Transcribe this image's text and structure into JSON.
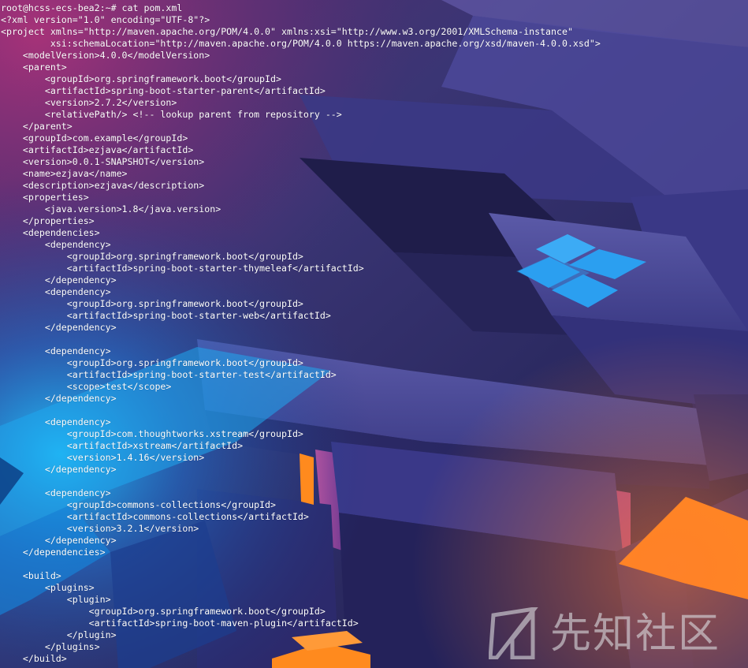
{
  "terminal": {
    "lines": [
      "root@hcss-ecs-bea2:~# cat pom.xml",
      "<?xml version=\"1.0\" encoding=\"UTF-8\"?>",
      "<project xmlns=\"http://maven.apache.org/POM/4.0.0\" xmlns:xsi=\"http://www.w3.org/2001/XMLSchema-instance\"",
      "         xsi:schemaLocation=\"http://maven.apache.org/POM/4.0.0 https://maven.apache.org/xsd/maven-4.0.0.xsd\">",
      "    <modelVersion>4.0.0</modelVersion>",
      "    <parent>",
      "        <groupId>org.springframework.boot</groupId>",
      "        <artifactId>spring-boot-starter-parent</artifactId>",
      "        <version>2.7.2</version>",
      "        <relativePath/> <!-- lookup parent from repository -->",
      "    </parent>",
      "    <groupId>com.example</groupId>",
      "    <artifactId>ezjava</artifactId>",
      "    <version>0.0.1-SNAPSHOT</version>",
      "    <name>ezjava</name>",
      "    <description>ezjava</description>",
      "    <properties>",
      "        <java.version>1.8</java.version>",
      "    </properties>",
      "    <dependencies>",
      "        <dependency>",
      "            <groupId>org.springframework.boot</groupId>",
      "            <artifactId>spring-boot-starter-thymeleaf</artifactId>",
      "        </dependency>",
      "        <dependency>",
      "            <groupId>org.springframework.boot</groupId>",
      "            <artifactId>spring-boot-starter-web</artifactId>",
      "        </dependency>",
      "",
      "        <dependency>",
      "            <groupId>org.springframework.boot</groupId>",
      "            <artifactId>spring-boot-starter-test</artifactId>",
      "            <scope>test</scope>",
      "        </dependency>",
      "",
      "        <dependency>",
      "            <groupId>com.thoughtworks.xstream</groupId>",
      "            <artifactId>xstream</artifactId>",
      "            <version>1.4.16</version>",
      "        </dependency>",
      "",
      "        <dependency>",
      "            <groupId>commons-collections</groupId>",
      "            <artifactId>commons-collections</artifactId>",
      "            <version>3.2.1</version>",
      "        </dependency>",
      "    </dependencies>",
      "",
      "    <build>",
      "        <plugins>",
      "            <plugin>",
      "                <groupId>org.springframework.boot</groupId>",
      "                <artifactId>spring-boot-maven-plugin</artifactId>",
      "            </plugin>",
      "        </plugins>",
      "    </build>"
    ]
  },
  "watermark": {
    "text": "先知社区"
  },
  "colors": {
    "text": "#ffffff",
    "background_deep": "#1a1838",
    "background_violet": "#3d3a7a",
    "accent_blue": "#2aa6f5",
    "accent_cyan": "#19c8ff",
    "accent_orange": "#ff8a1e",
    "accent_pink": "#d0489a"
  },
  "icons": [
    "windows-logo-icon",
    "xianzhi-logo-icon"
  ]
}
